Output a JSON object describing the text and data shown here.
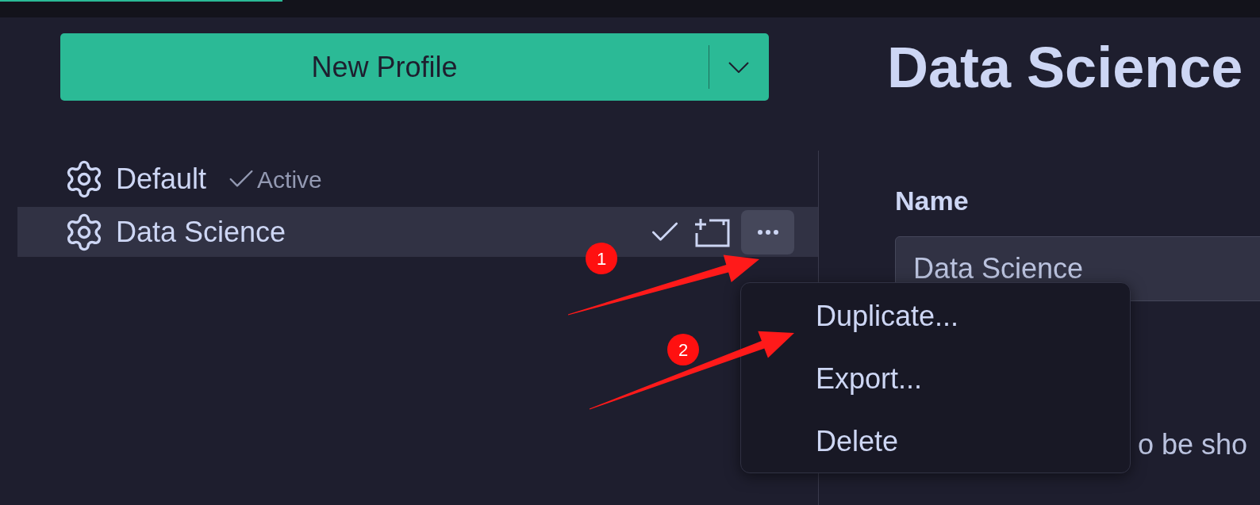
{
  "new_profile_button": {
    "label": "New Profile"
  },
  "title": "Data Science",
  "profiles": [
    {
      "name": "Default",
      "selected": false,
      "status": "Active"
    },
    {
      "name": "Data Science",
      "selected": true
    }
  ],
  "form": {
    "name_label": "Name",
    "name_value": "Data Science",
    "text_fragment": "o be sho"
  },
  "context_menu": {
    "items": [
      {
        "label": "Duplicate..."
      },
      {
        "label": "Export..."
      },
      {
        "label": "Delete"
      }
    ]
  },
  "annotations": [
    {
      "label": "1"
    },
    {
      "label": "2"
    }
  ]
}
